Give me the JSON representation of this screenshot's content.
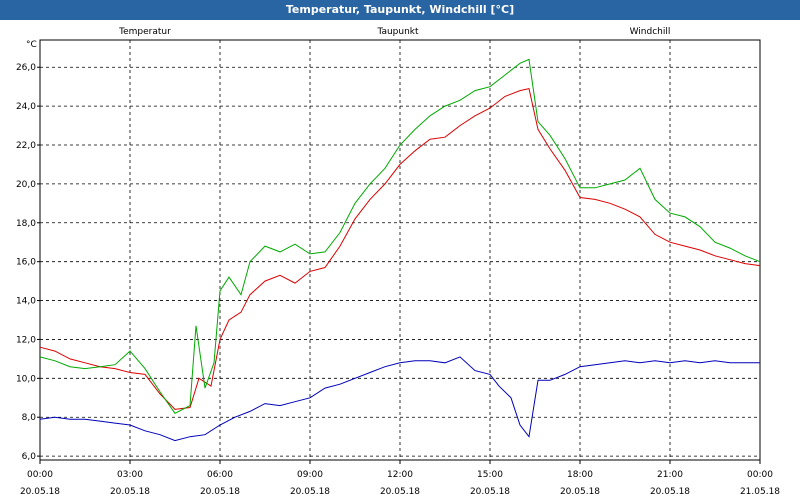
{
  "window": {
    "title": "Temperatur, Taupunkt, Windchill [°C]"
  },
  "chart_data": {
    "type": "line",
    "title": "Temperatur, Taupunkt, Windchill [°C]",
    "ylabel": "°C",
    "ylim": [
      5.8,
      27.4
    ],
    "yticks": [
      "6,0",
      "8,0",
      "10,0",
      "12,0",
      "14,0",
      "16,0",
      "18,0",
      "20,0",
      "22,0",
      "24,0",
      "26,0"
    ],
    "ytick_values": [
      6,
      8,
      10,
      12,
      14,
      16,
      18,
      20,
      22,
      24,
      26
    ],
    "xlim": [
      0,
      24
    ],
    "xticks": [
      {
        "time": "00:00",
        "date": "20.05.18"
      },
      {
        "time": "03:00",
        "date": "20.05.18"
      },
      {
        "time": "06:00",
        "date": "20.05.18"
      },
      {
        "time": "09:00",
        "date": "20.05.18"
      },
      {
        "time": "12:00",
        "date": "20.05.18"
      },
      {
        "time": "15:00",
        "date": "20.05.18"
      },
      {
        "time": "18:00",
        "date": "20.05.18"
      },
      {
        "time": "21:00",
        "date": "20.05.18"
      },
      {
        "time": "00:00",
        "date": "21.05.18"
      }
    ],
    "xtick_values": [
      0,
      3,
      6,
      9,
      12,
      15,
      18,
      21,
      24
    ],
    "grid": true,
    "legend_placement": "top",
    "series": [
      {
        "name": "Temperatur",
        "color": "#dd0000",
        "points": [
          [
            0,
            11.6
          ],
          [
            0.5,
            11.4
          ],
          [
            1,
            11.0
          ],
          [
            1.5,
            10.8
          ],
          [
            2,
            10.6
          ],
          [
            2.5,
            10.5
          ],
          [
            3,
            10.3
          ],
          [
            3.5,
            10.2
          ],
          [
            4,
            9.2
          ],
          [
            4.5,
            8.4
          ],
          [
            5,
            8.5
          ],
          [
            5.3,
            10.0
          ],
          [
            5.7,
            9.6
          ],
          [
            6.0,
            12.0
          ],
          [
            6.3,
            13.0
          ],
          [
            6.7,
            13.4
          ],
          [
            7,
            14.3
          ],
          [
            7.5,
            15.0
          ],
          [
            8,
            15.3
          ],
          [
            8.5,
            14.9
          ],
          [
            9,
            15.5
          ],
          [
            9.5,
            15.7
          ],
          [
            10,
            16.8
          ],
          [
            10.5,
            18.2
          ],
          [
            11,
            19.2
          ],
          [
            11.5,
            20.0
          ],
          [
            12,
            21.0
          ],
          [
            12.5,
            21.7
          ],
          [
            13,
            22.3
          ],
          [
            13.5,
            22.4
          ],
          [
            14,
            23.0
          ],
          [
            14.5,
            23.5
          ],
          [
            15,
            23.9
          ],
          [
            15.5,
            24.5
          ],
          [
            16,
            24.8
          ],
          [
            16.3,
            24.9
          ],
          [
            16.6,
            22.8
          ],
          [
            17,
            21.8
          ],
          [
            17.5,
            20.7
          ],
          [
            18,
            19.3
          ],
          [
            18.5,
            19.2
          ],
          [
            19,
            19.0
          ],
          [
            19.5,
            18.7
          ],
          [
            20,
            18.3
          ],
          [
            20.5,
            17.4
          ],
          [
            21,
            17.0
          ],
          [
            21.5,
            16.8
          ],
          [
            22,
            16.6
          ],
          [
            22.5,
            16.3
          ],
          [
            23,
            16.1
          ],
          [
            23.5,
            15.9
          ],
          [
            24,
            15.8
          ]
        ]
      },
      {
        "name": "Taupunkt",
        "color": "#0000bb",
        "points": [
          [
            0,
            7.9
          ],
          [
            0.5,
            8.0
          ],
          [
            1,
            7.9
          ],
          [
            1.5,
            7.9
          ],
          [
            2,
            7.8
          ],
          [
            2.5,
            7.7
          ],
          [
            3,
            7.6
          ],
          [
            3.5,
            7.3
          ],
          [
            4,
            7.1
          ],
          [
            4.5,
            6.8
          ],
          [
            5,
            7.0
          ],
          [
            5.5,
            7.1
          ],
          [
            6,
            7.6
          ],
          [
            6.5,
            8.0
          ],
          [
            7,
            8.3
          ],
          [
            7.5,
            8.7
          ],
          [
            8,
            8.6
          ],
          [
            8.5,
            8.8
          ],
          [
            9,
            9.0
          ],
          [
            9.5,
            9.5
          ],
          [
            10,
            9.7
          ],
          [
            10.5,
            10.0
          ],
          [
            11,
            10.3
          ],
          [
            11.5,
            10.6
          ],
          [
            12,
            10.8
          ],
          [
            12.5,
            10.9
          ],
          [
            13,
            10.9
          ],
          [
            13.5,
            10.8
          ],
          [
            14,
            11.1
          ],
          [
            14.5,
            10.4
          ],
          [
            15,
            10.2
          ],
          [
            15.3,
            9.6
          ],
          [
            15.7,
            9.0
          ],
          [
            16.0,
            7.6
          ],
          [
            16.3,
            7.0
          ],
          [
            16.6,
            9.9
          ],
          [
            17,
            9.9
          ],
          [
            17.5,
            10.2
          ],
          [
            18,
            10.6
          ],
          [
            18.5,
            10.7
          ],
          [
            19,
            10.8
          ],
          [
            19.5,
            10.9
          ],
          [
            20,
            10.8
          ],
          [
            20.5,
            10.9
          ],
          [
            21,
            10.8
          ],
          [
            21.5,
            10.9
          ],
          [
            22,
            10.8
          ],
          [
            22.5,
            10.9
          ],
          [
            23,
            10.8
          ],
          [
            23.5,
            10.8
          ],
          [
            24,
            10.8
          ]
        ]
      },
      {
        "name": "Windchill",
        "color": "#00aa00",
        "points": [
          [
            0,
            11.1
          ],
          [
            0.5,
            10.9
          ],
          [
            1,
            10.6
          ],
          [
            1.5,
            10.5
          ],
          [
            2,
            10.6
          ],
          [
            2.5,
            10.7
          ],
          [
            3,
            11.4
          ],
          [
            3.5,
            10.5
          ],
          [
            4,
            9.3
          ],
          [
            4.5,
            8.2
          ],
          [
            5,
            8.6
          ],
          [
            5.2,
            12.7
          ],
          [
            5.5,
            9.5
          ],
          [
            5.8,
            10.8
          ],
          [
            6.0,
            14.5
          ],
          [
            6.3,
            15.2
          ],
          [
            6.7,
            14.3
          ],
          [
            7,
            16.0
          ],
          [
            7.5,
            16.8
          ],
          [
            8,
            16.5
          ],
          [
            8.5,
            16.9
          ],
          [
            9,
            16.4
          ],
          [
            9.5,
            16.5
          ],
          [
            10,
            17.5
          ],
          [
            10.5,
            19.0
          ],
          [
            11,
            20.0
          ],
          [
            11.5,
            20.8
          ],
          [
            12,
            22.0
          ],
          [
            12.5,
            22.8
          ],
          [
            13,
            23.5
          ],
          [
            13.5,
            24.0
          ],
          [
            14,
            24.3
          ],
          [
            14.5,
            24.8
          ],
          [
            15,
            25.0
          ],
          [
            15.5,
            25.6
          ],
          [
            16,
            26.2
          ],
          [
            16.3,
            26.4
          ],
          [
            16.6,
            23.2
          ],
          [
            17,
            22.5
          ],
          [
            17.5,
            21.3
          ],
          [
            18,
            19.8
          ],
          [
            18.5,
            19.8
          ],
          [
            19,
            20.0
          ],
          [
            19.5,
            20.2
          ],
          [
            20,
            20.8
          ],
          [
            20.5,
            19.2
          ],
          [
            21,
            18.5
          ],
          [
            21.5,
            18.3
          ],
          [
            22,
            17.8
          ],
          [
            22.5,
            17.0
          ],
          [
            23,
            16.7
          ],
          [
            23.5,
            16.3
          ],
          [
            24,
            16.0
          ]
        ]
      }
    ]
  }
}
